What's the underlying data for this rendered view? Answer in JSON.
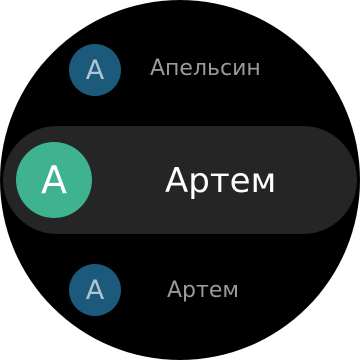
{
  "contacts": [
    {
      "initial": "А",
      "name": "Апельсин",
      "avatar_color": "#1c5a7c",
      "state": "faded"
    },
    {
      "initial": "А",
      "name": "Артем",
      "avatar_color": "#3fb38f",
      "state": "focused"
    },
    {
      "initial": "А",
      "name": "Артем",
      "avatar_color": "#1c5a7c",
      "state": "faded"
    }
  ],
  "colors": {
    "background": "#000000",
    "focused_row": "#252525",
    "faded_text": "#9a9a9a",
    "focused_text": "#ffffff"
  }
}
